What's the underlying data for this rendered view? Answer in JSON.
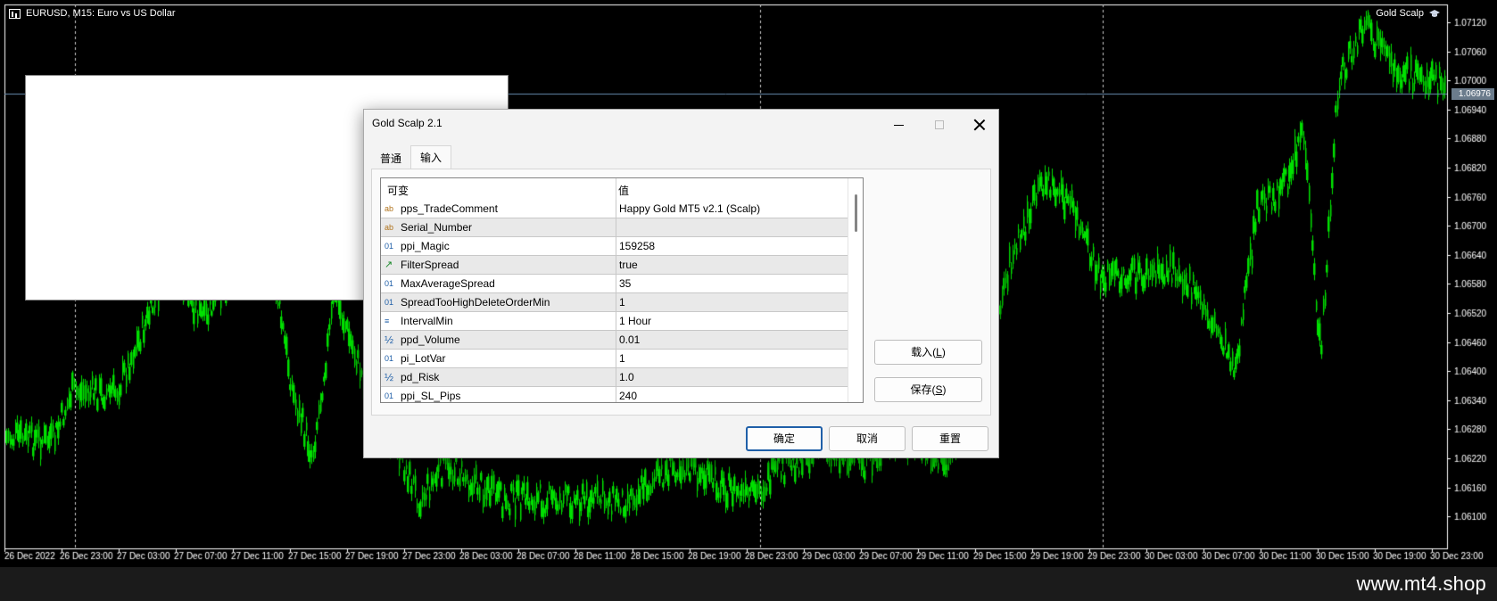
{
  "chart": {
    "symbol_label": "EURUSD, M15:  Euro vs US Dollar",
    "ea_label": "Gold Scalp",
    "current_price": "1.06976",
    "price_levels": [
      "1.07120",
      "1.07060",
      "1.07000",
      "1.06940",
      "1.06880",
      "1.06820",
      "1.06760",
      "1.06700",
      "1.06640",
      "1.06580",
      "1.06520",
      "1.06460",
      "1.06400",
      "1.06340",
      "1.06280",
      "1.06220",
      "1.06160",
      "1.06100"
    ],
    "time_labels": [
      "26 Dec 2022",
      "26 Dec 23:00",
      "27 Dec 03:00",
      "27 Dec 07:00",
      "27 Dec 11:00",
      "27 Dec 15:00",
      "27 Dec 19:00",
      "27 Dec 23:00",
      "28 Dec 03:00",
      "28 Dec 07:00",
      "28 Dec 11:00",
      "28 Dec 15:00",
      "28 Dec 19:00",
      "28 Dec 23:00",
      "29 Dec 03:00",
      "29 Dec 07:00",
      "29 Dec 11:00",
      "29 Dec 15:00",
      "29 Dec 19:00",
      "29 Dec 23:00",
      "30 Dec 03:00",
      "30 Dec 07:00",
      "30 Dec 11:00",
      "30 Dec 15:00",
      "30 Dec 19:00",
      "30 Dec 23:00"
    ],
    "candle_color": "#00e000",
    "background": "#000000",
    "price_line_color": "#6b8fb3"
  },
  "watermark": "www.mt4.shop",
  "dialog": {
    "title": "Gold Scalp 2.1",
    "tabs": [
      {
        "label": "普通",
        "active": false
      },
      {
        "label": "输入",
        "active": true
      }
    ],
    "grid": {
      "col_variable": "可变",
      "col_value": "值",
      "rows": [
        {
          "icon": "ab",
          "name": "pps_TradeComment",
          "value": "Happy Gold MT5 v2.1 (Scalp)"
        },
        {
          "icon": "ab",
          "name": "Serial_Number",
          "value": ""
        },
        {
          "icon": "01",
          "name": "ppi_Magic",
          "value": "159258"
        },
        {
          "icon": "bool",
          "name": "FilterSpread",
          "value": "true"
        },
        {
          "icon": "01",
          "name": "MaxAverageSpread",
          "value": "35"
        },
        {
          "icon": "01",
          "name": "SpreadTooHighDeleteOrderMin",
          "value": "1"
        },
        {
          "icon": "enum",
          "name": "IntervalMin",
          "value": "1 Hour"
        },
        {
          "icon": "½",
          "name": "ppd_Volume",
          "value": "0.01"
        },
        {
          "icon": "01",
          "name": "pi_LotVar",
          "value": "1"
        },
        {
          "icon": "½",
          "name": "pd_Risk",
          "value": "1.0"
        },
        {
          "icon": "01",
          "name": "ppi_SL_Pips",
          "value": "240"
        }
      ]
    },
    "buttons": {
      "load_label": "载入(",
      "load_key": "L",
      "save_label": "保存(",
      "save_key": "S",
      "close_paren": ")",
      "ok_label": "确定",
      "cancel_label": "取消",
      "reset_label": "重置"
    }
  }
}
